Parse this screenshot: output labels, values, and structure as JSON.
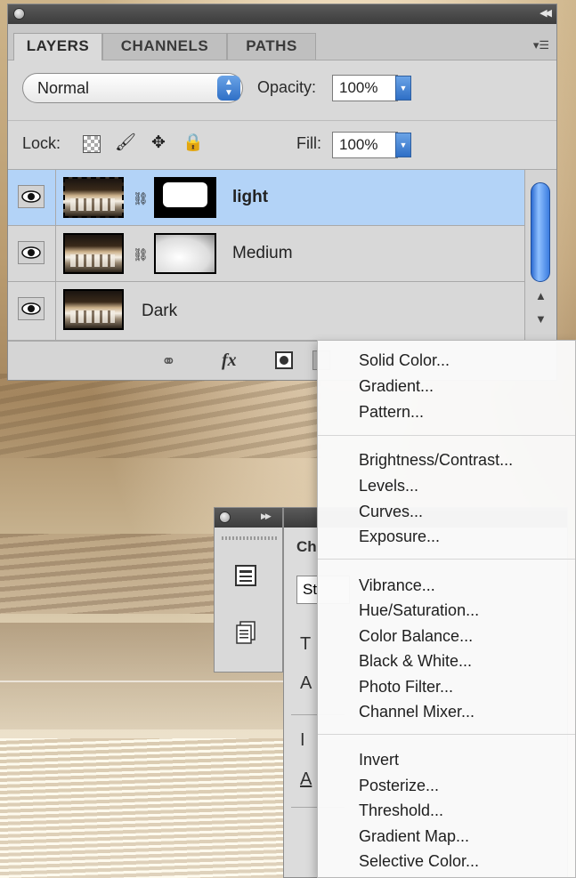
{
  "layers_panel": {
    "tabs": [
      "LAYERS",
      "CHANNELS",
      "PATHS"
    ],
    "blend_mode": "Normal",
    "opacity_label": "Opacity:",
    "opacity_value": "100%",
    "lock_label": "Lock:",
    "fill_label": "Fill:",
    "fill_value": "100%",
    "layers": [
      {
        "name": "light",
        "selected": true,
        "has_mask": true
      },
      {
        "name": "Medium",
        "selected": false,
        "has_mask": true
      },
      {
        "name": "Dark",
        "selected": false,
        "has_mask": false
      }
    ],
    "footer_icons": [
      "link-icon",
      "fx-icon",
      "add-mask-icon",
      "new-adjustment-layer-icon"
    ]
  },
  "tool_panel": {
    "icons": [
      "character-icon",
      "paragraph-icon"
    ]
  },
  "character_panel": {
    "tab_partial": "Ch",
    "field_partial": "St"
  },
  "adjustment_menu": {
    "groups": [
      [
        "Solid Color...",
        "Gradient...",
        "Pattern..."
      ],
      [
        "Brightness/Contrast...",
        "Levels...",
        "Curves...",
        "Exposure..."
      ],
      [
        "Vibrance...",
        "Hue/Saturation...",
        "Color Balance...",
        "Black & White...",
        "Photo Filter...",
        "Channel Mixer..."
      ],
      [
        "Invert",
        "Posterize...",
        "Threshold...",
        "Gradient Map...",
        "Selective Color..."
      ]
    ]
  },
  "colors": {
    "selection": "#b3d3f7",
    "accent_blue": "#2f6fc6",
    "panel_bg": "#d9d9d9"
  }
}
